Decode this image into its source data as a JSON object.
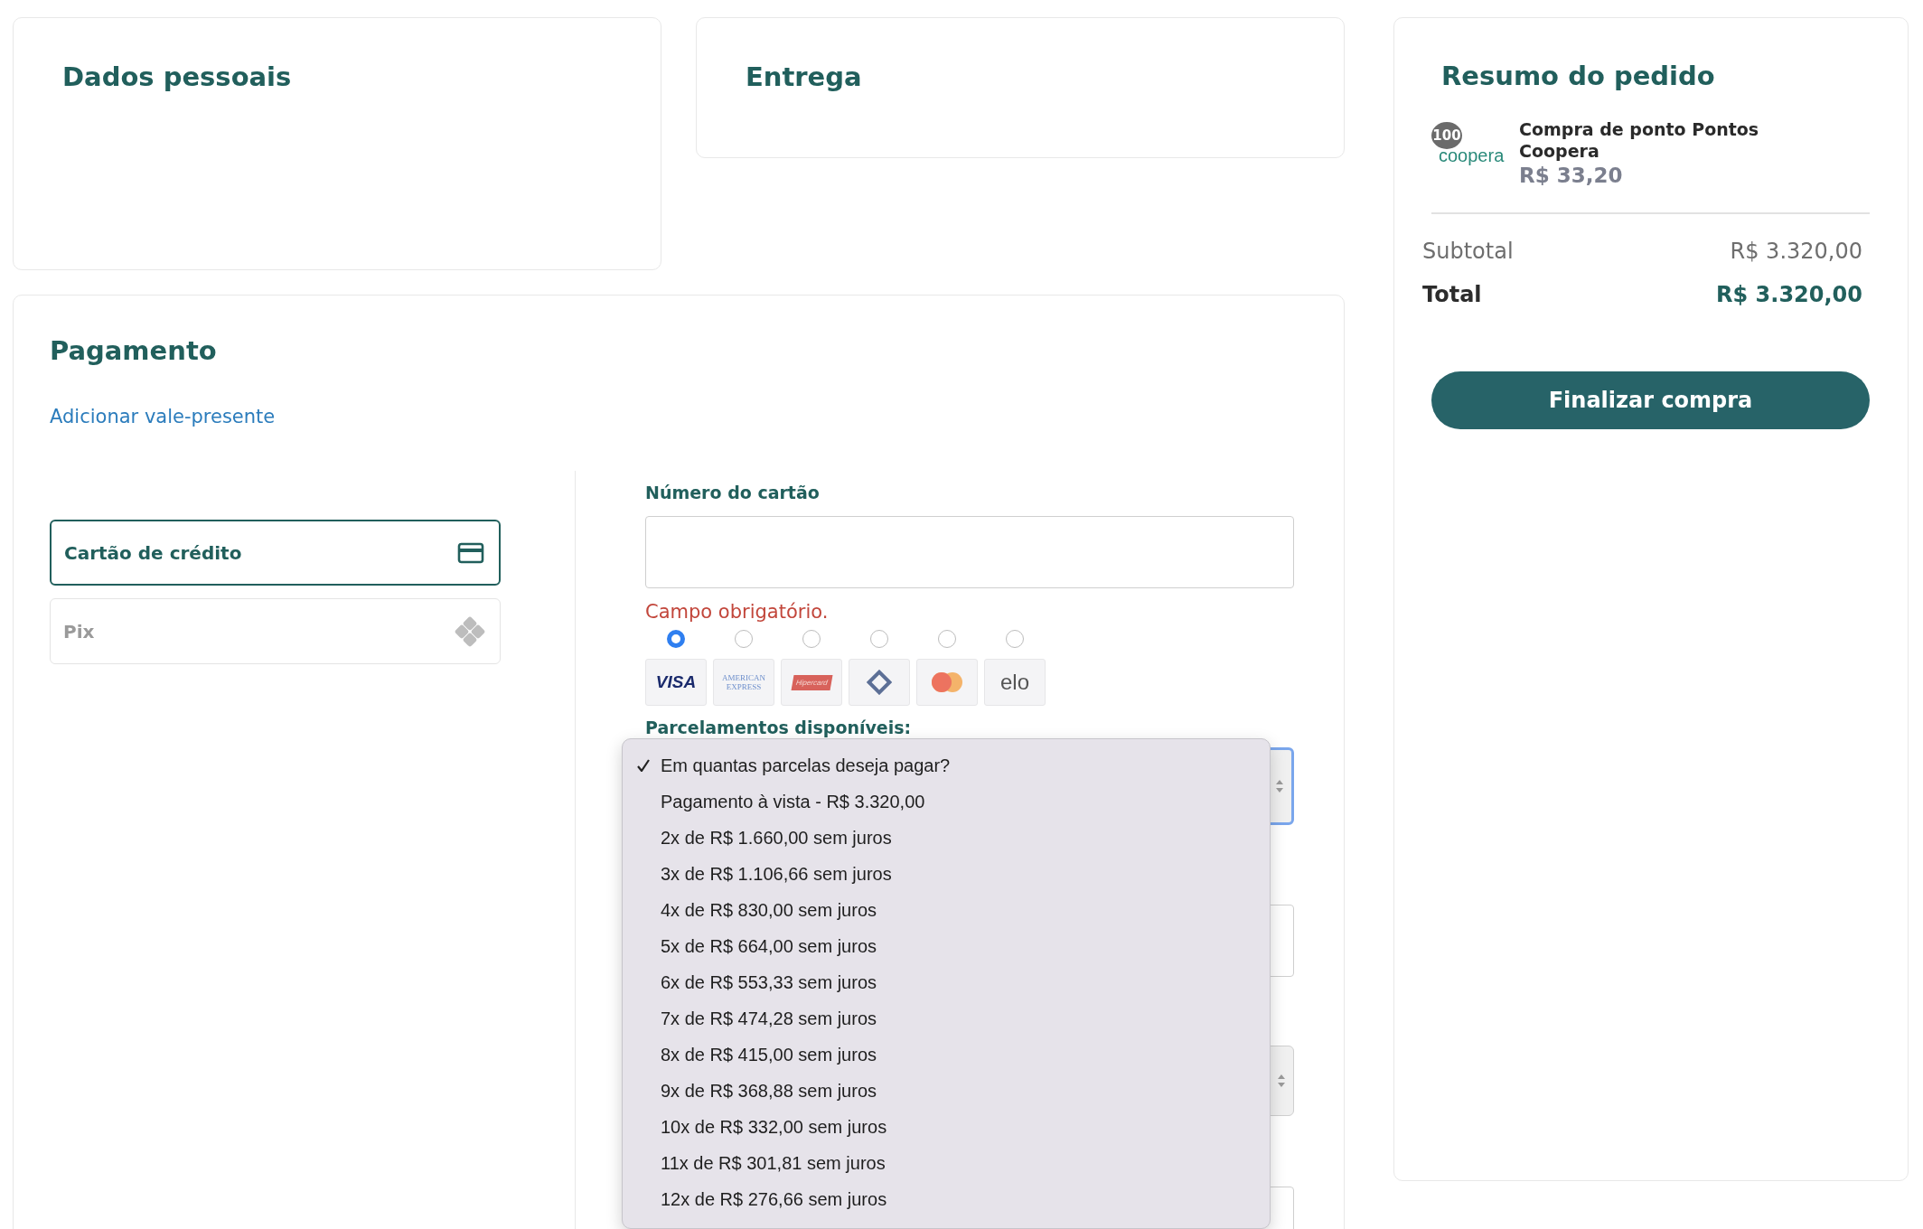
{
  "sections": [
    {
      "title": "Dados pessoais"
    },
    {
      "title": "Entrega"
    }
  ],
  "payment": {
    "title": "Pagamento",
    "gift_card_link": "Adicionar vale-presente",
    "methods": [
      {
        "label": "Cartão de crédito",
        "kind": "card",
        "selected": true
      },
      {
        "label": "Pix",
        "kind": "pix",
        "selected": false
      }
    ],
    "card_number": {
      "label": "Número do cartão",
      "error": "Campo obrigatório."
    },
    "brands": [
      {
        "kind": "visa",
        "text": "VISA",
        "selected": true
      },
      {
        "kind": "amex",
        "text": "AMERICAN EXPRESS",
        "selected": false
      },
      {
        "kind": "hipercard",
        "text": "Hipercard",
        "selected": false
      },
      {
        "kind": "diamond",
        "selected": false
      },
      {
        "kind": "mastercard",
        "selected": false
      },
      {
        "kind": "elo",
        "text": "elo",
        "selected": false
      }
    ],
    "installments": {
      "label": "Parcelamentos disponíveis:",
      "expanded": true,
      "options": [
        {
          "label": "Em quantas parcelas deseja pagar?",
          "selected": true
        },
        {
          "label": "Pagamento à vista - R$ 3.320,00",
          "selected": false
        },
        {
          "label": "2x de R$ 1.660,00 sem juros",
          "selected": false
        },
        {
          "label": "3x de R$ 1.106,66 sem juros",
          "selected": false
        },
        {
          "label": "4x de R$ 830,00 sem juros",
          "selected": false
        },
        {
          "label": "5x de R$ 664,00 sem juros",
          "selected": false
        },
        {
          "label": "6x de R$ 553,33 sem juros",
          "selected": false
        },
        {
          "label": "7x de R$ 474,28 sem juros",
          "selected": false
        },
        {
          "label": "8x de R$ 415,00 sem juros",
          "selected": false
        },
        {
          "label": "9x de R$ 368,88 sem juros",
          "selected": false
        },
        {
          "label": "10x de R$ 332,00 sem juros",
          "selected": false
        },
        {
          "label": "11x de R$ 301,81 sem juros",
          "selected": false
        },
        {
          "label": "12x de R$ 276,66 sem juros",
          "selected": false
        }
      ]
    }
  },
  "summary": {
    "title": "Resumo do pedido",
    "items": [
      {
        "badge": "100",
        "logo_text": "coopera",
        "name": "Compra de ponto Pontos Coopera",
        "price": "R$ 33,20"
      }
    ],
    "subtotal_label": "Subtotal",
    "subtotal": "R$ 3.320,00",
    "total_label": "Total",
    "total": "R$ 3.320,00",
    "button": "Finalizar compra"
  }
}
